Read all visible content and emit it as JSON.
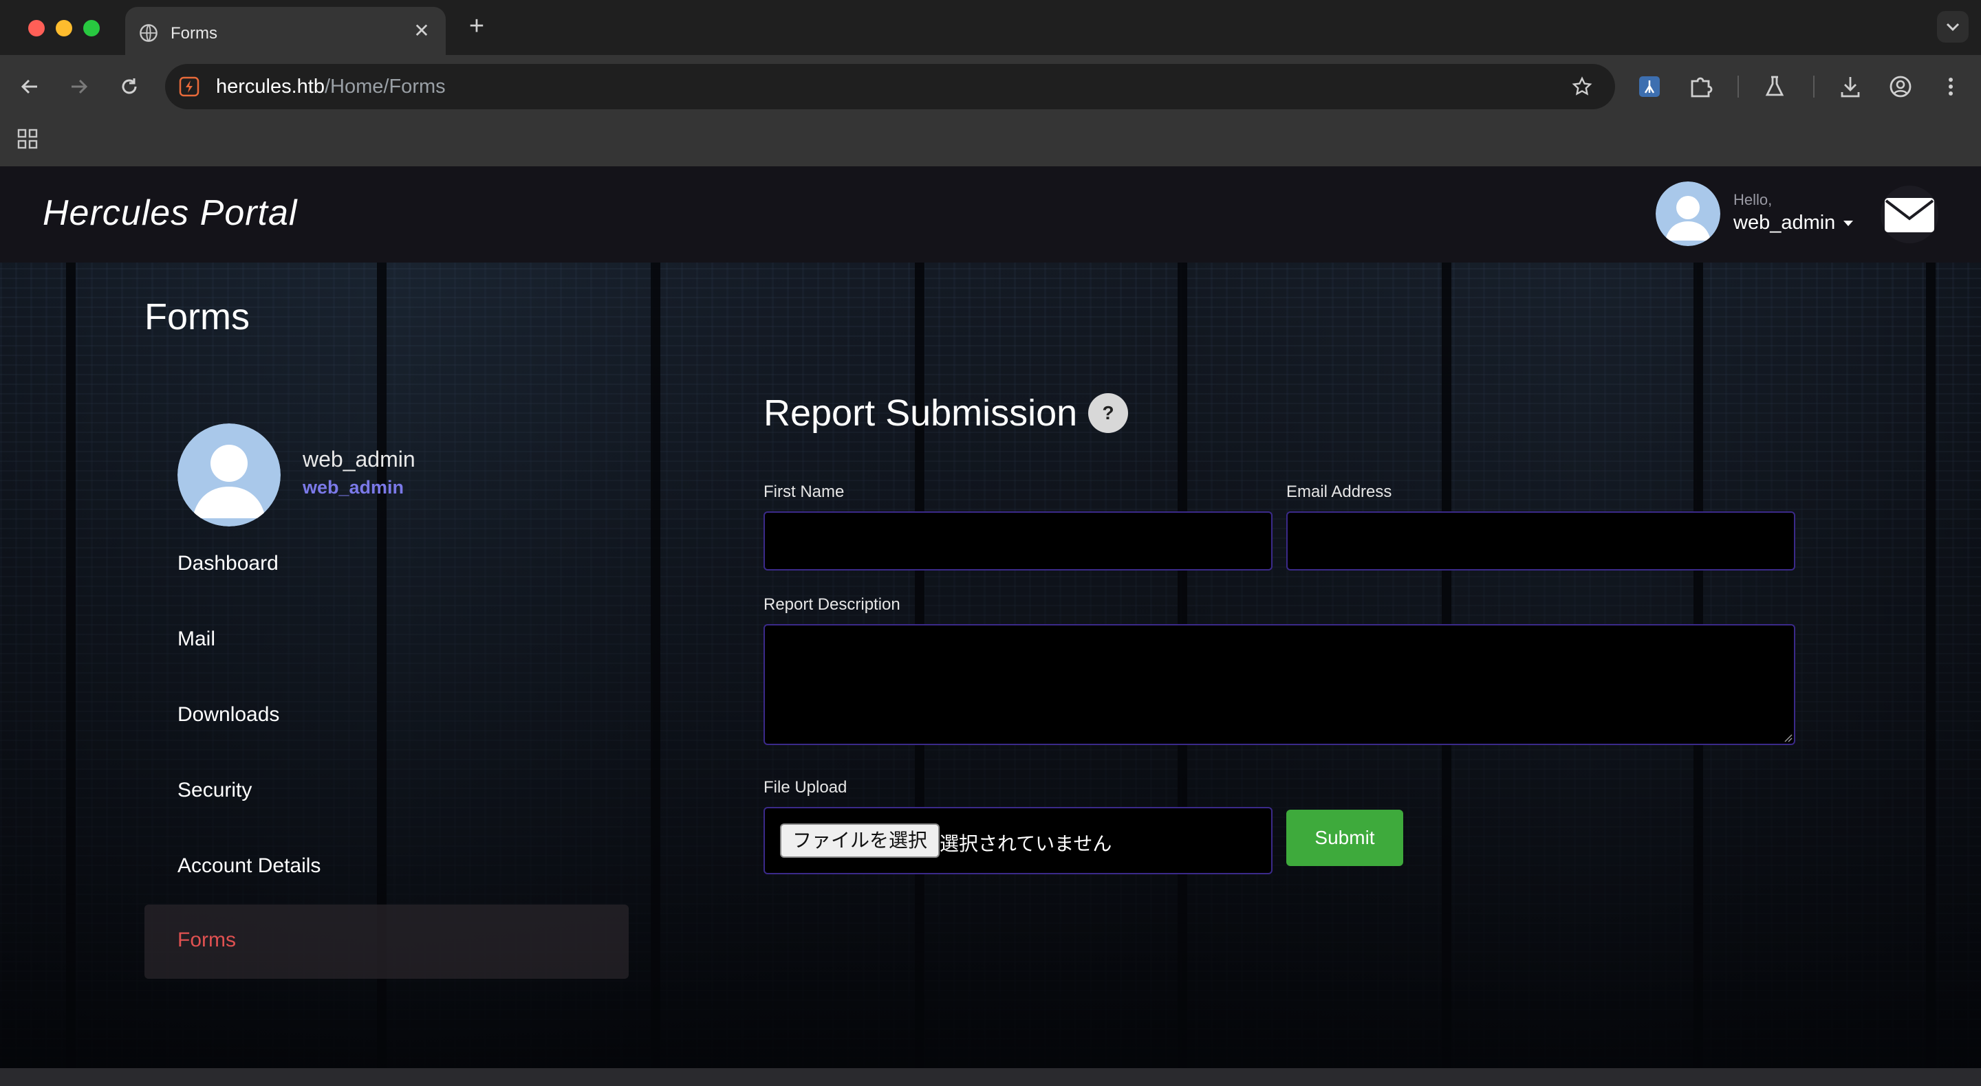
{
  "browser": {
    "tab_title": "Forms",
    "url_host": "hercules.htb",
    "url_path": "/Home/Forms",
    "icons": [
      "back-icon",
      "forward-icon",
      "reload-icon",
      "site-info-icon",
      "bookmark-star-icon",
      "extension-icon",
      "puzzle-icon",
      "labs-flask-icon",
      "download-icon",
      "profile-icon",
      "menu-dots-icon",
      "apps-grid-icon",
      "new-tab-icon",
      "tab-search-icon"
    ]
  },
  "header": {
    "brand": "Hercules Portal",
    "hello": "Hello,",
    "username": "web_admin"
  },
  "page": {
    "title": "Forms"
  },
  "sidebar": {
    "name": "web_admin",
    "handle": "web_admin",
    "items": [
      {
        "label": "Dashboard",
        "active": false
      },
      {
        "label": "Mail",
        "active": false
      },
      {
        "label": "Downloads",
        "active": false
      },
      {
        "label": "Security",
        "active": false
      },
      {
        "label": "Account Details",
        "active": false
      },
      {
        "label": "Forms",
        "active": true
      }
    ]
  },
  "form": {
    "title": "Report Submission",
    "help": "?",
    "first_name_label": "First Name",
    "first_name_value": "",
    "email_label": "Email Address",
    "email_value": "",
    "description_label": "Report Description",
    "description_value": "",
    "file_label": "File Upload",
    "file_button": "ファイルを選択",
    "file_status": "選択されていません",
    "submit": "Submit"
  },
  "colors": {
    "accent_active": "#e05151",
    "handle": "#7b79e8",
    "submit": "#3eaa3c",
    "field_border": "#3b2a8a"
  }
}
